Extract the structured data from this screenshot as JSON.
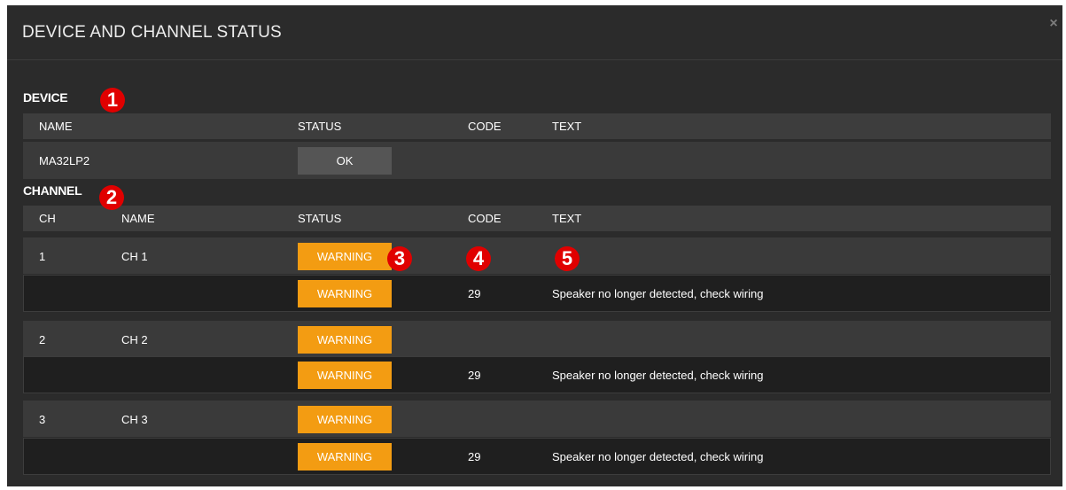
{
  "dialog": {
    "title": "DEVICE AND CHANNEL STATUS",
    "close_glyph": "×"
  },
  "device": {
    "section_label": "DEVICE",
    "columns": {
      "name": "NAME",
      "status": "STATUS",
      "code": "CODE",
      "text": "TEXT"
    },
    "row": {
      "name": "MA32LP2",
      "status": "OK",
      "code": "",
      "text": ""
    }
  },
  "channel": {
    "section_label": "CHANNEL",
    "columns": {
      "ch": "CH",
      "name": "NAME",
      "status": "STATUS",
      "code": "CODE",
      "text": "TEXT"
    },
    "rows": [
      {
        "ch": "1",
        "name": "CH 1",
        "status": "WARNING",
        "detail": {
          "status": "WARNING",
          "code": "29",
          "text": "Speaker no longer detected, check wiring"
        }
      },
      {
        "ch": "2",
        "name": "CH 2",
        "status": "WARNING",
        "detail": {
          "status": "WARNING",
          "code": "29",
          "text": "Speaker no longer detected, check wiring"
        }
      },
      {
        "ch": "3",
        "name": "CH 3",
        "status": "WARNING",
        "detail": {
          "status": "WARNING",
          "code": "29",
          "text": "Speaker no longer detected, check wiring"
        }
      }
    ]
  },
  "annotations": [
    "1",
    "2",
    "3",
    "4",
    "5"
  ],
  "colors": {
    "panel": "#2b2b2b",
    "header_row": "#3d3d3d",
    "warning": "#f39c12",
    "ok_button": "#555555",
    "marker": "#e00000"
  }
}
